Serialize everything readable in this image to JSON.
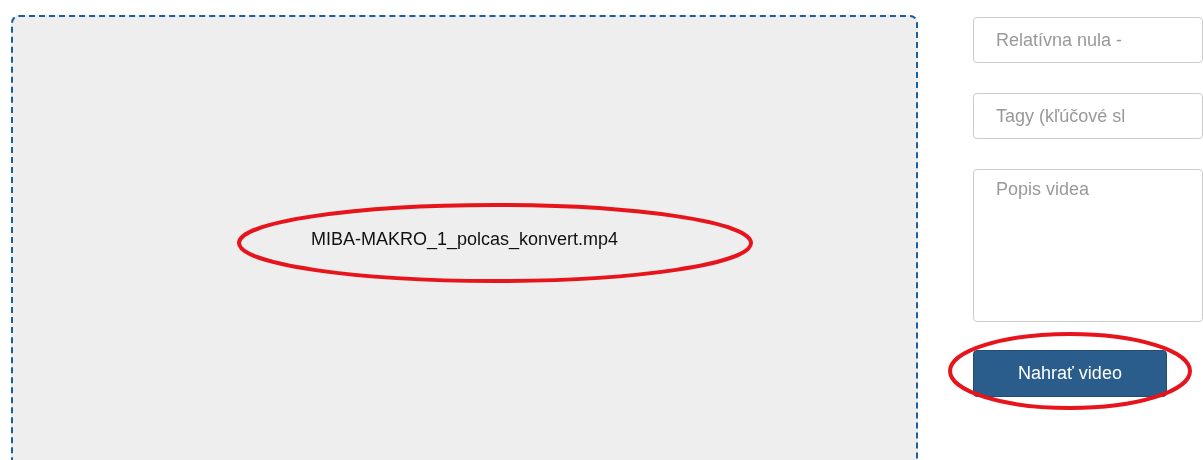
{
  "dropzone": {
    "file_name": "MIBA-MAKRO_1_polcas_konvert.mp4"
  },
  "fields": [
    {
      "kind": "input",
      "placeholder": "Relatívna nula -"
    },
    {
      "kind": "input",
      "placeholder": "Tagy (kľúčové sl"
    },
    {
      "kind": "textarea",
      "placeholder": "Popis videa"
    }
  ],
  "upload_button": {
    "label": "Nahrať video"
  }
}
